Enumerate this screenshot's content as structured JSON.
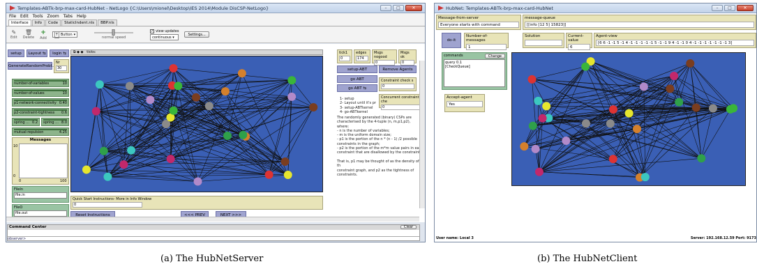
{
  "server": {
    "title": "Templates-ABTk-brp-max-card-HubNet - NetLogo {C:\\Users\\mionel\\Desktop\\IES 2014\\Module DisCSP-NetLogo}",
    "menu": [
      "File",
      "Edit",
      "Tools",
      "Zoom",
      "Tabs",
      "Help"
    ],
    "tabs": [
      "Interface",
      "Info",
      "Code",
      "StaticIndent.nls",
      "BBP.nls"
    ],
    "toolbar": {
      "edit": "Edit",
      "delete": "Delete",
      "add": "Add",
      "widget_type": "Button",
      "speed_label": "normal speed",
      "view_updates": "view updates",
      "update_mode": "continuous",
      "settings": "Settings..."
    },
    "buttons": {
      "setup": "setup",
      "layout": "Layout",
      "login": "login",
      "generate": "GenerateRandomProbl...",
      "setup_abt": "setup-ABT",
      "remove_agents": "Remove Agents",
      "go_abt1": "go ABT",
      "go_abt2": "go ABT",
      "reset_instructions": "Reset Instructions",
      "prev": "<<< PREV",
      "next": "NEXT >>>"
    },
    "nr_monitor": {
      "label": "Nr",
      "value": "30"
    },
    "sliders": [
      {
        "label": "number-of-variables",
        "value": "10"
      },
      {
        "label": "number-of-values",
        "value": "10"
      },
      {
        "label": "p1-network-connectivity",
        "value": "0.40"
      },
      {
        "label": "p2-constraint-tightness",
        "value": "0.6"
      }
    ],
    "spring_sliders": [
      {
        "label": "spring ...",
        "value": "0.2"
      },
      {
        "label": "spring ...",
        "value": "8.0"
      }
    ],
    "repulsion_slider": {
      "label": "mutual-repulsion",
      "value": "4.25"
    },
    "messages_plot": {
      "title": "Messages",
      "ymax": "10",
      "ymin": "0",
      "xmin": "0",
      "xmax": "100"
    },
    "file_in": {
      "label": "FileIn",
      "value": "file.in"
    },
    "file_out": {
      "label": "FileO",
      "value": "file.out"
    },
    "view_label": "ticks:",
    "monitors": [
      {
        "label": "tick1",
        "value": "0"
      },
      {
        "label": "edges",
        "value": "174"
      },
      {
        "label": "Msgs nogood",
        "value": "0"
      },
      {
        "label": "Msgs ok",
        "value": "0"
      }
    ],
    "constraint_check": {
      "label": "Constraint check s",
      "value": "0"
    },
    "concurrent_check": {
      "label": "Concurrent constraint che",
      "value": "0"
    },
    "steps": [
      "1- setup",
      "2- Layout until it's pr",
      "3- setup-ABTkernel",
      "4- go-ABTkernel"
    ],
    "description": [
      "The randomly generated (binary) CSPs are",
      "characterised by the 4-tuple (n, m,p1,p2),",
      "where:",
      "- n is the number of variables;",
      "- m is the uniform domain size;",
      "- p1 is the portion of the n * (n - 1) /2 possible",
      "  constraints in the graph;",
      "- p2 is the portion of the m*m value pairs in eac",
      "constraint that are disallowed by the constraint.",
      "",
      "That is, p1 may be thought of as the density of th",
      "constraint graph, and p2 as the tightness of",
      "constraints."
    ],
    "quick_start": {
      "label": "Quick Start Instructions- More in Info Window",
      "value": "0"
    },
    "command_center": {
      "title": "Command Center",
      "clear": "Clear",
      "prompt": "observer>"
    }
  },
  "client": {
    "title": "HubNet: Templates-ABTk-brp-max-card-HubNet",
    "message_from_server": {
      "label": "Message-from-server",
      "value": "Everyone starts with command"
    },
    "message_queue": {
      "label": "message-queue",
      "value": "[[info [12 5] 15823]]"
    },
    "doit": "do-it",
    "number_of_messages": {
      "label": "Number-of-messages",
      "value": "1"
    },
    "solution": {
      "label": "Solution",
      "value": ""
    },
    "current_value": {
      "label": "Current-value",
      "value": "6"
    },
    "agent_view": {
      "label": "Agent-view",
      "value": "[6 6 -1 -1 5 -1 4 -1 -1 -1 -1 -1 5 -1 -1 9 4 -1 -1 0 4 -1 -1 -1 -1 -1 -1 -1 3]"
    },
    "commands": {
      "label": "commands",
      "button": "Change",
      "value": "query 0.1\n[CheckQueue]"
    },
    "accept_agent": {
      "label": "Accept-agent",
      "value": "Yes"
    },
    "user_name": "User name: Local 3",
    "server_info": "Server: 192.168.12.59  Port: 9173"
  },
  "captions": {
    "a": "(a)  The HubNetServer",
    "b": "(b)  The HubNetClient"
  }
}
